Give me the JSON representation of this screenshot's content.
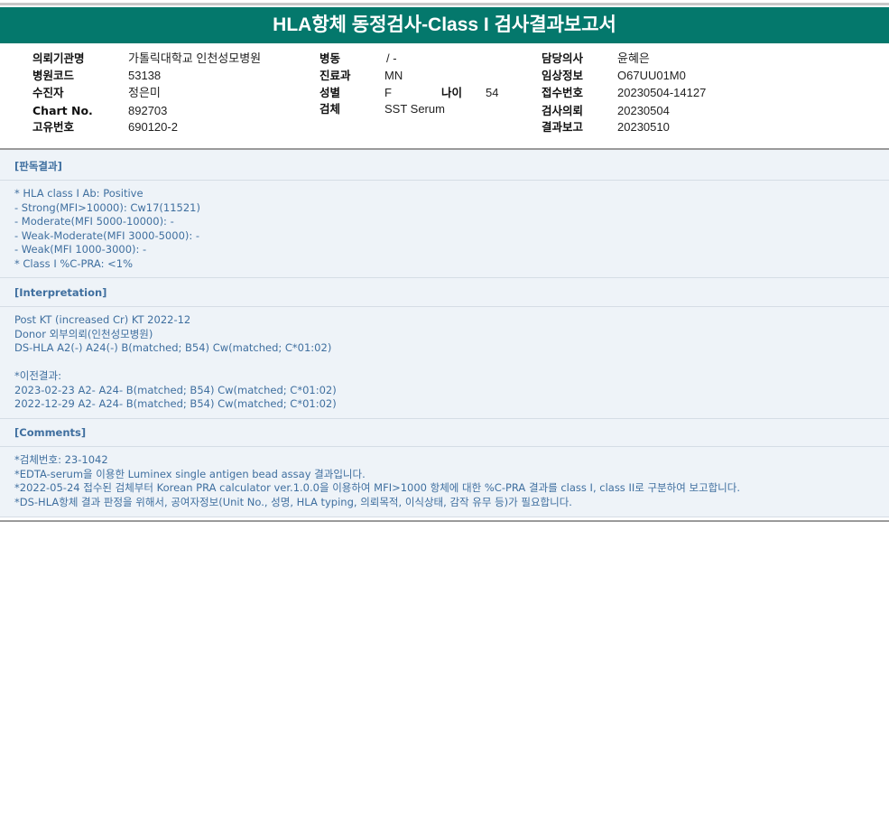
{
  "header": {
    "title": "HLA항체 동정검사-Class I 검사결과보고서"
  },
  "patient_info": {
    "col1": [
      {
        "label": "의뢰기관명",
        "value": "가톨릭대학교 인천성모병원"
      },
      {
        "label": "병원코드",
        "value": "53138"
      },
      {
        "label": "수진자",
        "value": "정은미"
      },
      {
        "label": "Chart No.",
        "value": "892703"
      },
      {
        "label": "고유번호",
        "value": "690120-2"
      }
    ],
    "col2": [
      {
        "label": "병동",
        "value": "/ -"
      },
      {
        "label": "진료과",
        "value": "MN"
      },
      {
        "label": "성별",
        "value": "F"
      },
      {
        "label": "검체",
        "value": "SST Serum"
      }
    ],
    "age": {
      "label": "나이",
      "value": "54"
    },
    "col3": [
      {
        "label": "담당의사",
        "value": "윤혜은"
      },
      {
        "label": "임상정보",
        "value": "O67UU01M0"
      },
      {
        "label": "접수번호",
        "value": "20230504-14127"
      },
      {
        "label": "검사의뢰",
        "value": "20230504"
      },
      {
        "label": "결과보고",
        "value": "20230510"
      }
    ]
  },
  "sections": {
    "result": {
      "heading": "[판독결과]",
      "lines": [
        "* HLA class I Ab: Positive",
        "- Strong(MFI>10000): Cw17(11521)",
        "- Moderate(MFI 5000-10000): -",
        "- Weak-Moderate(MFI 3000-5000): -",
        "- Weak(MFI 1000-3000): -",
        "* Class I %C-PRA: <1%"
      ]
    },
    "interpretation": {
      "heading": "[Interpretation]",
      "lines": [
        "Post KT (increased Cr) KT 2022-12",
        "Donor 외부의뢰(인천성모병원)",
        "DS-HLA A2(-) A24(-) B(matched; B54) Cw(matched; C*01:02)",
        "",
        "*이전결과:",
        "2023-02-23 A2- A24- B(matched; B54) Cw(matched; C*01:02)",
        "2022-12-29 A2- A24- B(matched; B54) Cw(matched; C*01:02)"
      ]
    },
    "comments": {
      "heading": "[Comments]",
      "lines": [
        "*검체번호: 23-1042",
        "*EDTA-serum을 이용한 Luminex single antigen bead assay 결과입니다.",
        "*2022-05-24 접수된 검체부터 Korean PRA calculator ver.1.0.0을 이용하여 MFI>1000 항체에 대한 %C-PRA 결과를 class I, class II로 구분하여 보고합니다.",
        "*DS-HLA항체 결과 판정을 위해서, 공여자정보(Unit No., 성명, HLA typing, 의뢰목적, 이식상태, 감작 유무 등)가 필요합니다."
      ]
    }
  },
  "colors": {
    "title_bg": "#04786c",
    "report_bg": "#eef3f8",
    "report_text": "#3f6f9f"
  }
}
